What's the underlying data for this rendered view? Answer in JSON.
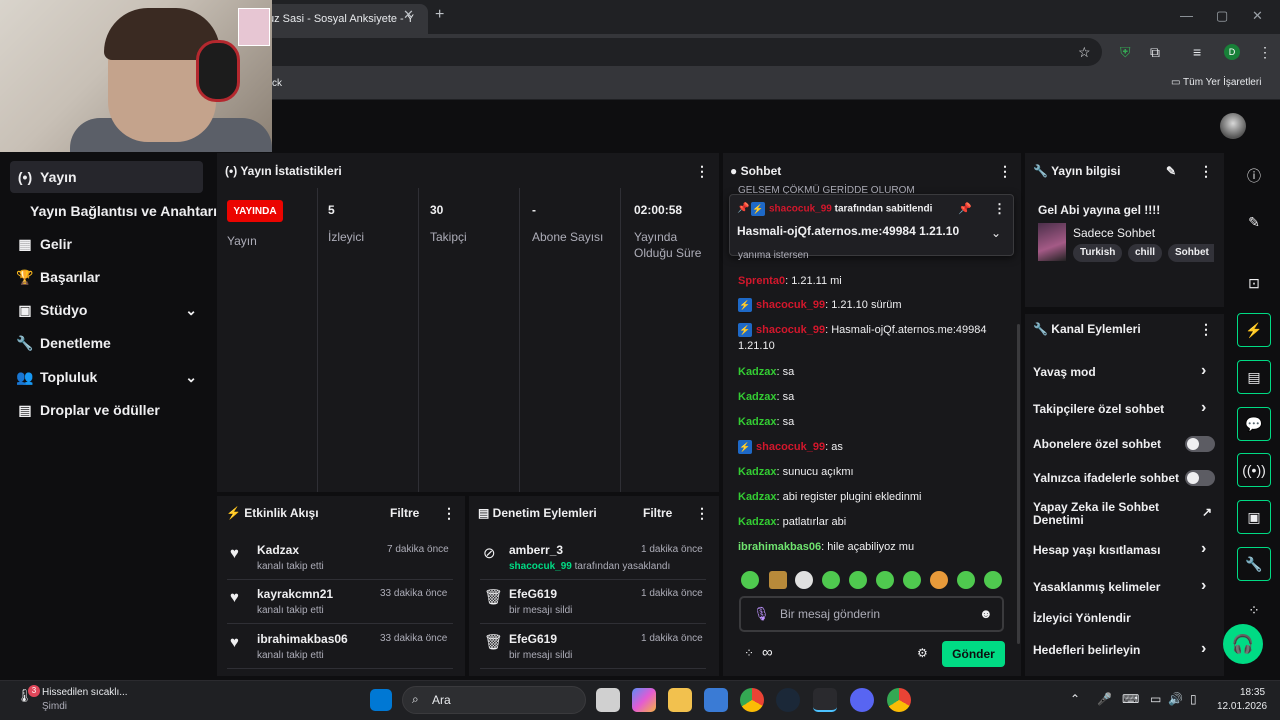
{
  "browser": {
    "tab_title": "uz Sasi - Sosyal Anksiyete - Y",
    "bookmark_left": "ck",
    "bookmark_all": "Tüm Yer İşaretleri",
    "profile_initial": "D"
  },
  "nav": {
    "items": [
      {
        "label": "Yayın",
        "icon": "(•)"
      },
      {
        "label": "Yayın Bağlantısı ve Anahtarı",
        "icon": ""
      },
      {
        "label": "Gelir",
        "icon": "▦"
      },
      {
        "label": "Başarılar",
        "icon": "🏆"
      },
      {
        "label": "Stüdyo",
        "icon": "▣"
      },
      {
        "label": "Denetleme",
        "icon": "🔧"
      },
      {
        "label": "Topluluk",
        "icon": "👥"
      },
      {
        "label": "Droplar ve ödüller",
        "icon": "▤"
      }
    ]
  },
  "stats": {
    "title": "Yayın İstatistikleri",
    "live_badge": "YAYINDA",
    "live_label": "Yayın",
    "viewers_value": "5",
    "viewers_label": "İzleyici",
    "followers_value": "30",
    "followers_label": "Takipçi",
    "subs_value": "-",
    "subs_label": "Abone Sayısı",
    "uptime_value": "02:00:58",
    "uptime_label": "Yayında Olduğu Süre"
  },
  "activity": {
    "title": "Etkinlik Akışı",
    "filter": "Filtre",
    "rows": [
      {
        "name": "Kadzax",
        "sub": "kanalı takip etti",
        "time": "7 dakika önce"
      },
      {
        "name": "kayrakcmn21",
        "sub": "kanalı takip etti",
        "time": "33 dakika önce"
      },
      {
        "name": "ibrahimakbas06",
        "sub": "kanalı takip etti",
        "time": "33 dakika önce"
      }
    ]
  },
  "moderation": {
    "title": "Denetim Eylemleri",
    "filter": "Filtre",
    "rows": [
      {
        "name": "amberr_3",
        "actor": "shacocuk_99",
        "sub": "tarafından yasaklandı",
        "time": "1 dakika önce"
      },
      {
        "name": "EfeG619",
        "actor": "",
        "sub": "bir mesajı sildi",
        "time": "1 dakika önce"
      },
      {
        "name": "EfeG619",
        "actor": "",
        "sub": "bir mesajı sildi",
        "time": "1 dakika önce"
      }
    ]
  },
  "chat": {
    "title": "Sohbet",
    "top_cut": "GELSEM ÇÖKMÜ GERİDDE OLUROM",
    "pinned_by_user": "shacocuk_99",
    "pinned_by_text": "tarafından sabitlendi",
    "pinned_message": "Hasmali-ojQf.aternos.me:49984 1.21.10",
    "partial_line": "yanıma istersen",
    "messages": [
      {
        "user": "Sprenta0",
        "text": ": 1.21.11 mi",
        "style": "red",
        "badge": false
      },
      {
        "user": "shacocuk_99",
        "text": ": 1.21.10 sürüm",
        "style": "red",
        "badge": true
      },
      {
        "user": "shacocuk_99",
        "text": ": Hasmali-ojQf.aternos.me:49984 1.21.10",
        "style": "red",
        "badge": true
      },
      {
        "user": "Kadzax",
        "text": ": sa",
        "style": "green",
        "badge": false
      },
      {
        "user": "Kadzax",
        "text": ": sa",
        "style": "green",
        "badge": false
      },
      {
        "user": "Kadzax",
        "text": ": sa",
        "style": "green",
        "badge": false
      },
      {
        "user": "shacocuk_99",
        "text": ": as",
        "style": "red",
        "badge": true
      },
      {
        "user": "Kadzax",
        "text": ": sunucu açıkmı",
        "style": "green",
        "badge": false
      },
      {
        "user": "Kadzax",
        "text": ": abi register plugini ekledinmi",
        "style": "green",
        "badge": false
      },
      {
        "user": "Kadzax",
        "text": ": patlatırlar abi",
        "style": "green",
        "badge": false
      },
      {
        "user": "ibrahimakbas06",
        "text": ": hile açabiliyoz mu",
        "style": "lime",
        "badge": false
      }
    ],
    "input_placeholder": "Bir mesaj gönderin",
    "points": "∞",
    "send_label": "Gönder"
  },
  "stream_info": {
    "title": "Yayın bilgisi",
    "stream_title": "Gel Abi yayına gel !!!!",
    "category": "Sadece Sohbet",
    "tags": [
      "Turkish",
      "chill",
      "Sohbet"
    ]
  },
  "channel_actions": {
    "title": "Kanal Eylemleri",
    "rows": [
      {
        "label": "Yavaş mod",
        "control": "chevron"
      },
      {
        "label": "Takipçilere özel sohbet",
        "control": "chevron"
      },
      {
        "label": "Abonelere özel sohbet",
        "control": "toggle",
        "on": false
      },
      {
        "label": "Yalnızca ifadelerle sohbet",
        "control": "toggle",
        "on": false
      },
      {
        "label": "Yapay Zeka ile Sohbet Denetimi",
        "control": "external"
      },
      {
        "label": "Hesap yaşı kısıtlaması",
        "control": "chevron"
      },
      {
        "label": "Yasaklanmış kelimeler",
        "control": "chevron"
      },
      {
        "label": "İzleyici Yönlendir",
        "control": "none"
      },
      {
        "label": "Hedefleri belirleyin",
        "control": "chevron"
      }
    ]
  },
  "taskbar": {
    "weather_badge": "3",
    "weather_text": "Hissedilen sıcaklı...",
    "weather_sub": "Şimdi",
    "search_label": "Ara",
    "time": "18:35",
    "date": "12.01.2026"
  },
  "colors": {
    "accent": "#00db84",
    "live": "#eb0400",
    "panel": "#18181b",
    "background": "#0e0e10"
  }
}
